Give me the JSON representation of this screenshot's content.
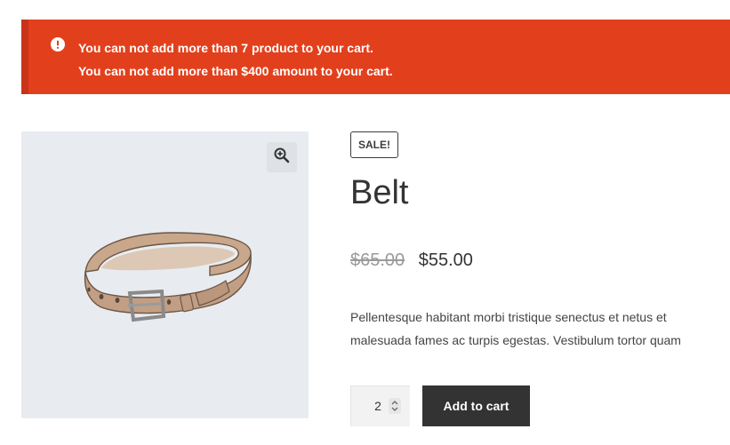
{
  "notices": {
    "icon": "exclamation-circle-icon",
    "color": "#e2401c",
    "messages": [
      "You can not add more than 7 product to your cart.",
      "You can not add more than $400 amount to your cart."
    ]
  },
  "gallery": {
    "zoom_icon": "magnifier-plus-icon",
    "image": "belt-product-image"
  },
  "product": {
    "badge": "SALE!",
    "title": "Belt",
    "regular_price": "$65.00",
    "sale_price": "$55.00",
    "description": "Pellentesque habitant morbi tristique senectus et netus et malesuada fames ac turpis egestas. Vestibulum tortor quam"
  },
  "cart_form": {
    "quantity": "2",
    "button_label": "Add to cart"
  }
}
